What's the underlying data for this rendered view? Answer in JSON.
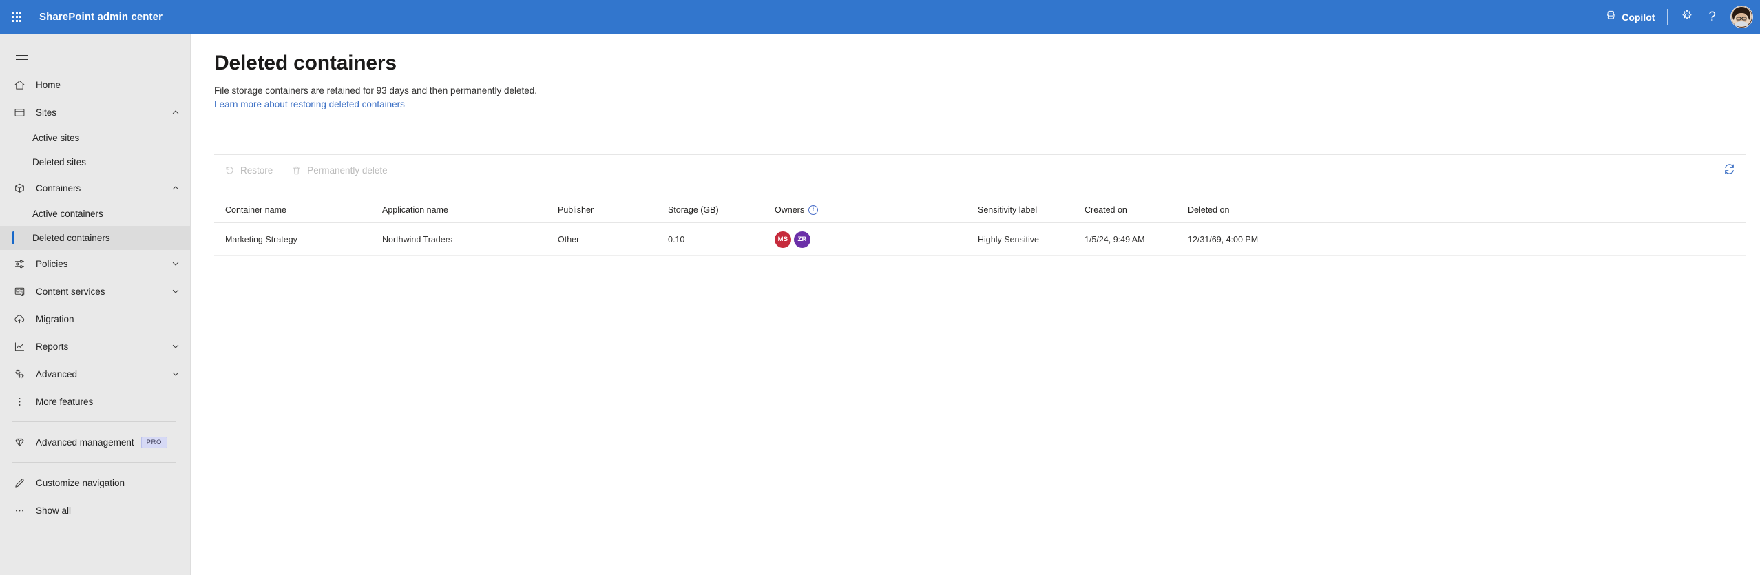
{
  "header": {
    "waffle_icon": "app-launcher-icon",
    "brand": "SharePoint admin center",
    "copilot_label": "Copilot",
    "copilot_icon": "copilot-icon",
    "settings_icon": "gear-icon",
    "help_icon": "question-mark-icon",
    "help_glyph": "?",
    "avatar_icon": "user-avatar",
    "bg_color": "#3276cd"
  },
  "sidebar": {
    "hamburger_icon": "hamburger-menu-icon",
    "bg_color": "#e9e9e9",
    "selected_indicator_color": "#1768c9",
    "items": [
      {
        "label": "Home",
        "icon": "home-icon",
        "type": "item",
        "chevron": ""
      },
      {
        "label": "Sites",
        "icon": "window-icon",
        "type": "item",
        "chevron": "expanded"
      },
      {
        "label": "Active sites",
        "icon": "",
        "type": "sub",
        "selected": false
      },
      {
        "label": "Deleted sites",
        "icon": "",
        "type": "sub",
        "selected": false
      },
      {
        "label": "Containers",
        "icon": "box-icon",
        "type": "item",
        "chevron": "expanded"
      },
      {
        "label": "Active containers",
        "icon": "",
        "type": "sub",
        "selected": false
      },
      {
        "label": "Deleted containers",
        "icon": "",
        "type": "sub",
        "selected": true
      },
      {
        "label": "Policies",
        "icon": "sliders-icon",
        "type": "item",
        "chevron": "collapsed"
      },
      {
        "label": "Content services",
        "icon": "content-services-icon",
        "type": "item",
        "chevron": "collapsed"
      },
      {
        "label": "Migration",
        "icon": "cloud-upload-icon",
        "type": "item",
        "chevron": ""
      },
      {
        "label": "Reports",
        "icon": "line-chart-icon",
        "type": "item",
        "chevron": "collapsed"
      },
      {
        "label": "Advanced",
        "icon": "gears-icon",
        "type": "item",
        "chevron": "collapsed"
      },
      {
        "label": "More features",
        "icon": "vertical-dots-icon",
        "type": "item",
        "chevron": ""
      }
    ],
    "advanced_management": {
      "label": "Advanced management",
      "icon": "diamond-icon",
      "badge": "PRO",
      "badge_bg": "#d6d9f5"
    },
    "customize_navigation": {
      "label": "Customize navigation",
      "icon": "pencil-icon"
    },
    "show_all": {
      "label": "Show all",
      "icon": "ellipsis-icon"
    }
  },
  "main": {
    "title": "Deleted containers",
    "description": "File storage containers are retained for 93 days and then permanently deleted.",
    "link": "Learn more about restoring deleted containers",
    "link_color": "#3b6fc4"
  },
  "commandbar": {
    "restore": {
      "label": "Restore",
      "icon": "restore-arrow-icon",
      "disabled": true
    },
    "permanently_delete": {
      "label": "Permanently delete",
      "icon": "trash-icon",
      "disabled": true
    },
    "refresh": {
      "icon": "refresh-icon",
      "color": "#3b6fc4"
    }
  },
  "table": {
    "columns": [
      {
        "key": "container_name",
        "label": "Container name"
      },
      {
        "key": "application_name",
        "label": "Application name"
      },
      {
        "key": "publisher",
        "label": "Publisher"
      },
      {
        "key": "storage_gb",
        "label": "Storage (GB)"
      },
      {
        "key": "owners",
        "label": "Owners",
        "info_icon": "info-icon"
      },
      {
        "key": "sensitivity",
        "label": "Sensitivity label"
      },
      {
        "key": "created_on",
        "label": "Created on"
      },
      {
        "key": "deleted_on",
        "label": "Deleted on"
      }
    ],
    "rows": [
      {
        "container_name": "Marketing Strategy",
        "application_name": "Northwind Traders",
        "publisher": "Other",
        "storage_gb": "0.10",
        "owners": [
          {
            "initials": "MS",
            "color": "#c62b3c"
          },
          {
            "initials": "ZR",
            "color": "#6b2fa8"
          }
        ],
        "sensitivity": "Highly Sensitive",
        "created_on": "1/5/24, 9:49 AM",
        "deleted_on": "12/31/69, 4:00 PM"
      }
    ]
  }
}
